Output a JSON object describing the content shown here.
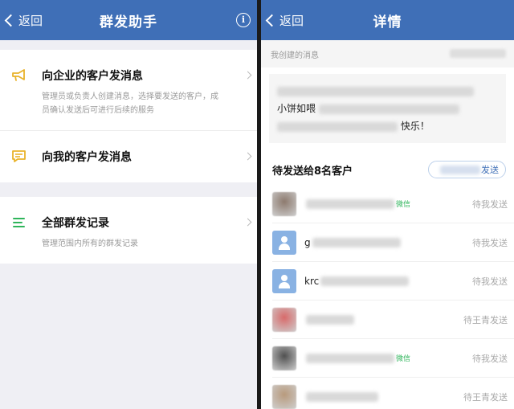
{
  "left": {
    "nav": {
      "back_label": "返回",
      "title": "群发助手"
    },
    "items": [
      {
        "title": "向企业的客户发消息",
        "desc": "管理员或负责人创建消息，选择要发送的客户，成员确认发送后可进行后续的服务"
      },
      {
        "title": "向我的客户发消息",
        "desc": ""
      }
    ],
    "records": {
      "title": "全部群发记录",
      "desc": "管理范围内所有的群发记录"
    }
  },
  "right": {
    "nav": {
      "back_label": "返回",
      "title": "详情"
    },
    "msg_header": "我创建的消息",
    "msg_lines": [
      "小饼如喂",
      "快乐！"
    ],
    "pending_title": "待发送给8名客户",
    "send_button": "发送",
    "customers": [
      {
        "name": "",
        "tag": "微信",
        "status": "待我发送",
        "avatar": "photo",
        "avatar_color": "#8d7a6e"
      },
      {
        "name": "g",
        "tag": "",
        "status": "待我发送",
        "avatar": "default",
        "avatar_color": "#89b2e3"
      },
      {
        "name": "krc",
        "tag": "",
        "status": "待我发送",
        "avatar": "default",
        "avatar_color": "#89b2e3"
      },
      {
        "name": "",
        "tag": "",
        "status": "待王青发送",
        "avatar": "photo",
        "avatar_color": "#d86a6a"
      },
      {
        "name": "",
        "tag": "微信",
        "status": "待我发送",
        "avatar": "photo",
        "avatar_color": "#505050"
      },
      {
        "name": "",
        "tag": "",
        "status": "待王青发送",
        "avatar": "photo",
        "avatar_color": "#b89a7c"
      }
    ]
  },
  "colors": {
    "nav_bg": "#3f6fb7",
    "accent_green": "#2fb55b",
    "accent_yellow": "#e9b32b"
  }
}
